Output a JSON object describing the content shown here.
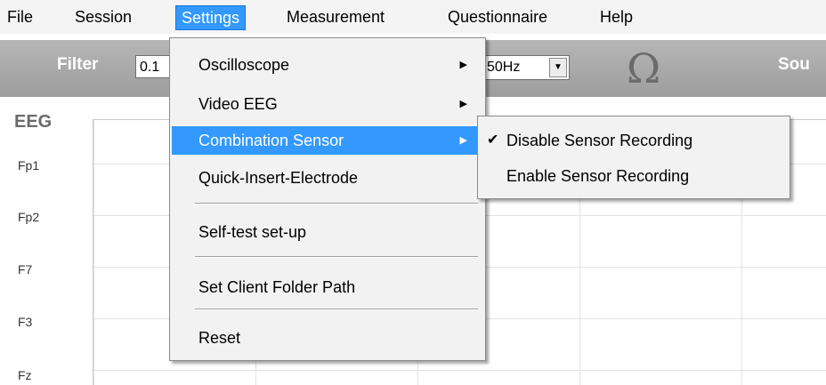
{
  "menubar": {
    "items": [
      {
        "label": "File"
      },
      {
        "label": "Session"
      },
      {
        "label": "Settings"
      },
      {
        "label": "Measurement"
      },
      {
        "label": "Questionnaire"
      },
      {
        "label": "Help"
      }
    ],
    "active_item": "Settings",
    "accent_color": "#3399ff"
  },
  "toolbar": {
    "filter_label": "Filter",
    "filter_value": "0.1",
    "notch_value": "50Hz",
    "ohm_symbol": "Ω",
    "sound_label_partial": "Sou"
  },
  "eeg": {
    "title": "EEG",
    "channels": [
      "Fp1",
      "Fp2",
      "F7",
      "F3",
      "Fz"
    ]
  },
  "settings_menu": {
    "items": [
      {
        "label": "Oscilloscope",
        "has_submenu": true
      },
      {
        "label": "Video EEG",
        "has_submenu": true
      },
      {
        "label": "Combination Sensor",
        "has_submenu": true,
        "highlighted": true
      },
      {
        "label": "Quick-Insert-Electrode"
      },
      {
        "label": "Self-test set-up"
      },
      {
        "label": "Set Client Folder Path"
      },
      {
        "label": "Reset"
      }
    ]
  },
  "combination_sensor_submenu": {
    "items": [
      {
        "label": "Disable Sensor Recording",
        "checked": true
      },
      {
        "label": "Enable Sensor Recording",
        "checked": false
      }
    ]
  }
}
